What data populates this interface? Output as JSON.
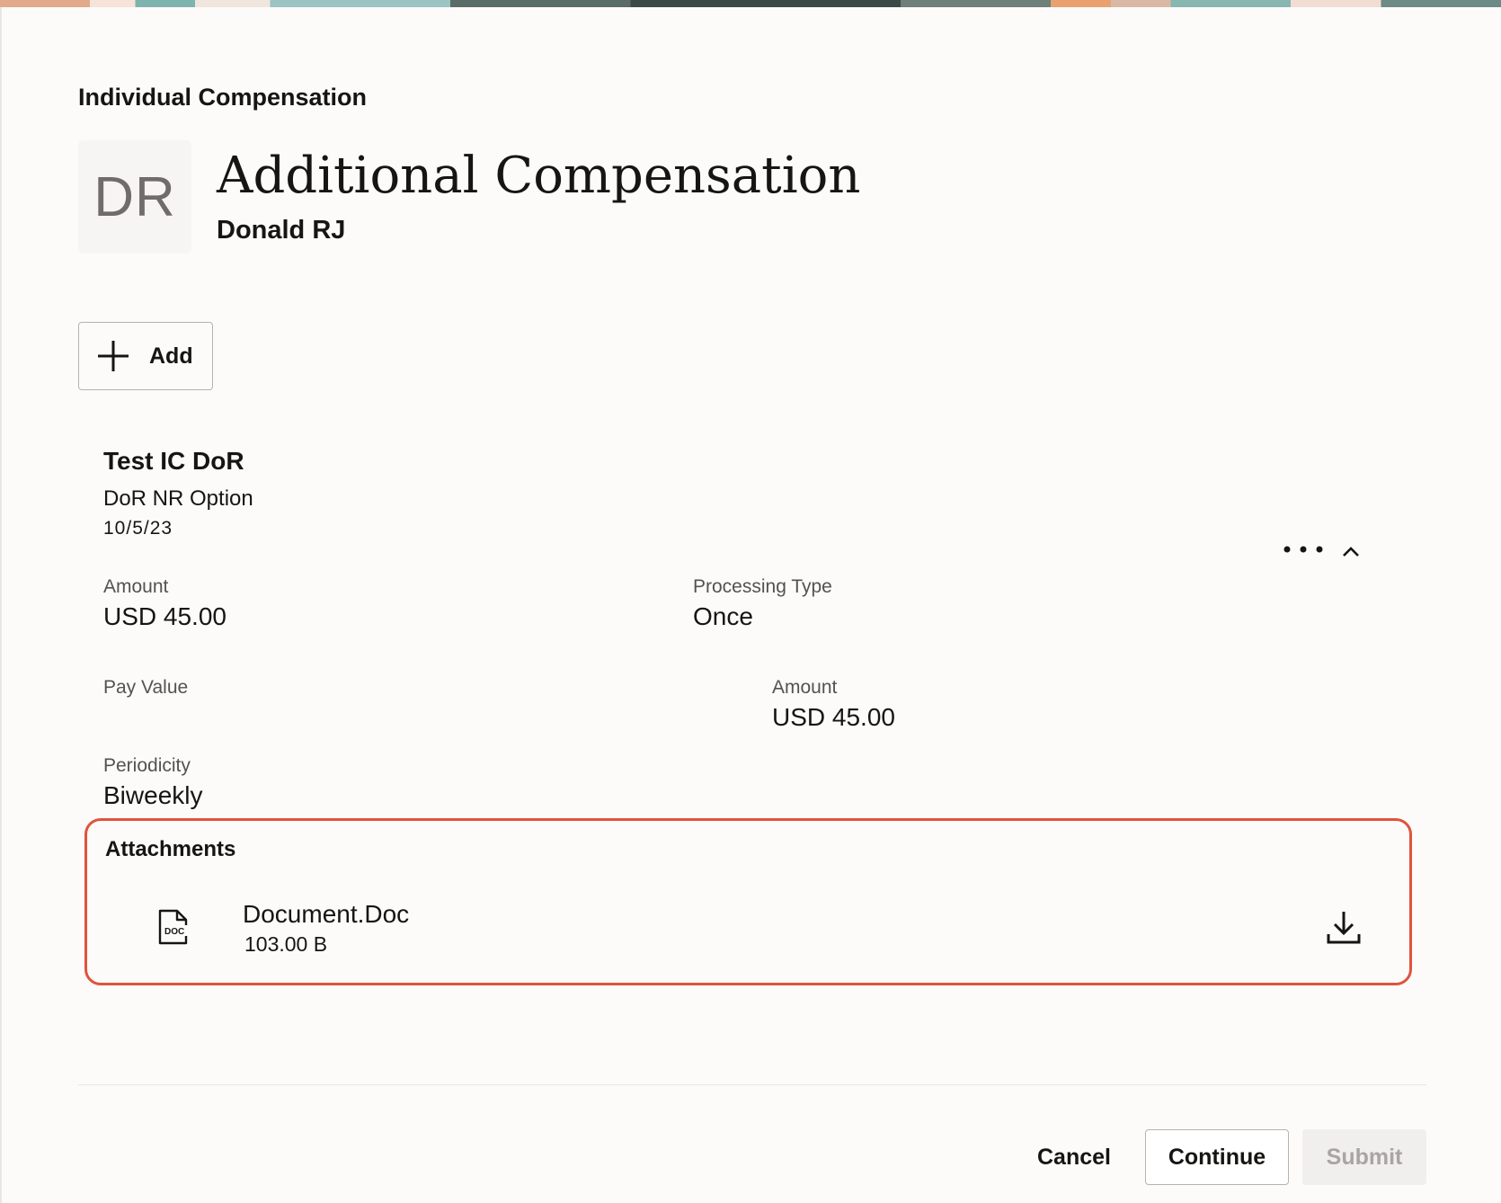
{
  "header": {
    "kicker": "Individual Compensation",
    "avatar_initials": "DR",
    "title": "Additional Compensation",
    "person_name": "Donald RJ"
  },
  "toolbar": {
    "add_label": "Add"
  },
  "record": {
    "title": "Test IC DoR",
    "option": "DoR NR Option",
    "date": "10/5/23",
    "fields": {
      "amount_label": "Amount",
      "amount_value": "USD 45.00",
      "processing_type_label": "Processing Type",
      "processing_type_value": "Once",
      "pay_value_label": "Pay Value",
      "amount2_label": "Amount",
      "amount2_value": "USD 45.00",
      "periodicity_label": "Periodicity",
      "periodicity_value": "Biweekly"
    }
  },
  "attachments": {
    "heading": "Attachments",
    "file": {
      "icon_label": "DOC",
      "name": "Document.Doc",
      "size": "103.00 B"
    }
  },
  "footer": {
    "cancel_label": "Cancel",
    "continue_label": "Continue",
    "submit_label": "Submit"
  },
  "colors": {
    "highlight_border": "#e0533d",
    "text": "#161513",
    "muted": "#55524e"
  },
  "icons": [
    "plus-icon",
    "more-options-icon",
    "chevron-up-icon",
    "doc-file-icon",
    "download-icon"
  ]
}
